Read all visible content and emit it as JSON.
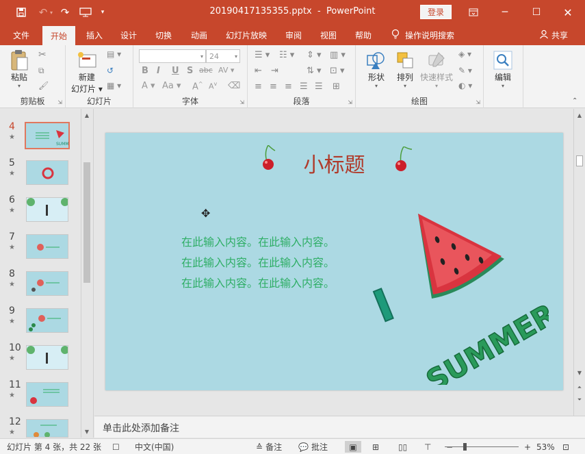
{
  "titlebar": {
    "filename": "20190417135355.pptx",
    "separator": "-",
    "app": "PowerPoint",
    "login_label": "登录"
  },
  "tabs": [
    "文件",
    "开始",
    "插入",
    "设计",
    "切换",
    "动画",
    "幻灯片放映",
    "审阅",
    "视图",
    "帮助"
  ],
  "active_tab": "开始",
  "tell_me": "操作说明搜索",
  "share_label": "共享",
  "ribbon": {
    "clipboard": {
      "label": "剪贴板",
      "paste": "粘贴"
    },
    "slides": {
      "label": "幻灯片",
      "new_slide_line1": "新建",
      "new_slide_line2": "幻灯片"
    },
    "font": {
      "label": "字体",
      "size": "24"
    },
    "paragraph": {
      "label": "段落"
    },
    "drawing": {
      "label": "绘图",
      "shapes": "形状",
      "arrange": "排列",
      "quick_styles": "快速样式"
    },
    "editing": {
      "label": "编辑"
    }
  },
  "thumbnails": [
    {
      "num": "4",
      "active": true
    },
    {
      "num": "5"
    },
    {
      "num": "6"
    },
    {
      "num": "7"
    },
    {
      "num": "8"
    },
    {
      "num": "9"
    },
    {
      "num": "10"
    },
    {
      "num": "11"
    },
    {
      "num": "12"
    }
  ],
  "slide": {
    "title": "小标题",
    "lines": [
      "在此输入内容。在此输入内容。",
      "在此输入内容。在此输入内容。",
      "在此输入内容。在此输入内容。"
    ],
    "art_text_1": "I",
    "art_text_2": "SUMMER"
  },
  "notes_placeholder": "单击此处添加备注",
  "status": {
    "slide_info": "幻灯片 第 4 张，共 22 张",
    "language": "中文(中国)",
    "notes": "备注",
    "comments": "批注",
    "zoom": "53%",
    "zoom_fraction": 0.53
  },
  "colors": {
    "accent": "#c7472c",
    "slide_bg": "#acd9e3",
    "title_red": "#b03a2a",
    "text_green": "#2fae66"
  }
}
